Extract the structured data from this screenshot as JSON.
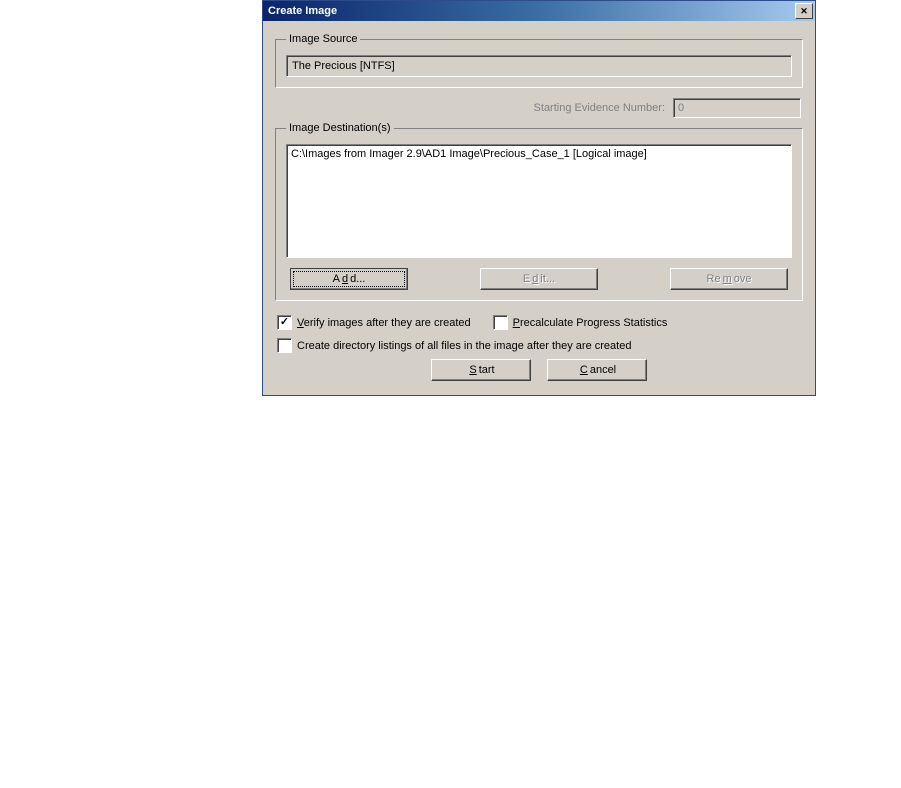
{
  "title": "Create Image",
  "source": {
    "legend": "Image Source",
    "value": "The Precious [NTFS]"
  },
  "evidence": {
    "label": "Starting Evidence Number:",
    "value": "0"
  },
  "destination": {
    "legend": "Image Destination(s)",
    "items": [
      "C:\\Images from Imager 2.9\\AD1 Image\\Precious_Case_1 [Logical image]"
    ],
    "buttons": {
      "add_prefix": "A",
      "add_accel": "d",
      "add_suffix": "d...",
      "edit_prefix": "E",
      "edit_accel": "d",
      "edit_suffix": "it...",
      "remove_prefix": "Re",
      "remove_accel": "m",
      "remove_suffix": "ove"
    }
  },
  "options": {
    "verify_prefix": "",
    "verify_accel": "V",
    "verify_suffix": "erify images after they are created",
    "precalc_prefix": "",
    "precalc_accel": "P",
    "precalc_suffix": "recalculate Progress Statistics",
    "listing": "Create directory listings of all files in the image after they are created",
    "verify_checked": true,
    "precalc_checked": false,
    "listing_checked": false
  },
  "actions": {
    "start_prefix": "",
    "start_accel": "S",
    "start_suffix": "tart",
    "cancel_prefix": "",
    "cancel_accel": "C",
    "cancel_suffix": "ancel"
  }
}
